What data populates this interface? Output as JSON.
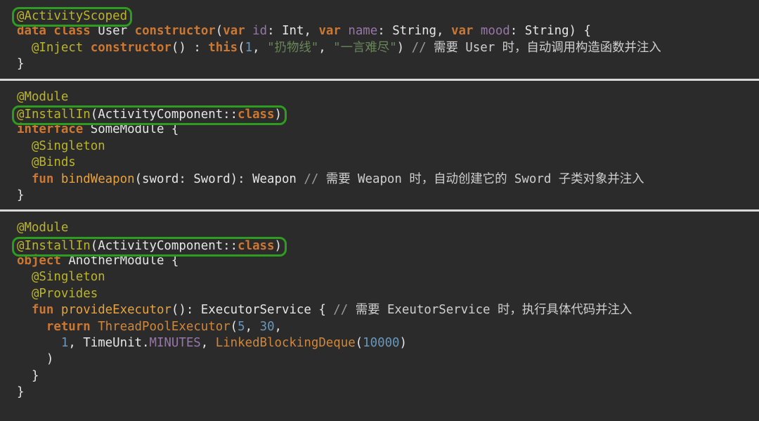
{
  "theme": {
    "background": "#2b2b2b",
    "foreground": "#e6e6e6",
    "keyword": "#cc7832",
    "annotation": "#bbb529",
    "function_name": "#e8a33d",
    "constructor_call": "#d0873a",
    "parameter": "#9876aa",
    "number": "#6897bb",
    "string": "#6a8759",
    "comment": "#9a9a9a",
    "highlight_border": "#2e9b21",
    "separator": "#d8d8d8"
  },
  "blocks": [
    {
      "id": "block-activity-scoped-user",
      "highlighted_annotation": "@ActivityScoped",
      "lines": [
        {
          "id": "b1l1",
          "text": "@ActivityScoped"
        },
        {
          "id": "b1l2",
          "text": "data class User constructor(var id: Int, var name: String, var mood: String) {"
        },
        {
          "id": "b1l3",
          "text": "  @Inject constructor() : this(1, \"扔物线\", \"一言难尽\") // 需要 User 时，自动调用构造函数并注入"
        },
        {
          "id": "b1l4",
          "text": "}"
        }
      ],
      "tokens": {
        "keywords": [
          "data",
          "class",
          "constructor",
          "var",
          "this"
        ],
        "annotations": [
          "@ActivityScoped",
          "@Inject"
        ],
        "types": [
          "User",
          "Int",
          "String"
        ],
        "parameters": [
          "id",
          "name",
          "mood"
        ],
        "numbers": [
          "1"
        ],
        "strings": [
          "\"扔物线\"",
          "\"一言难尽\""
        ],
        "comment": "// 需要 User 时，自动调用构造函数并注入"
      }
    },
    {
      "id": "block-some-module",
      "highlighted_annotation": "@InstallIn(ActivityComponent::class)",
      "lines": [
        {
          "id": "b2l1",
          "text": "@Module"
        },
        {
          "id": "b2l2",
          "text": "@InstallIn(ActivityComponent::class)"
        },
        {
          "id": "b2l3",
          "text": "interface SomeModule {"
        },
        {
          "id": "b2l4",
          "text": "  @Singleton"
        },
        {
          "id": "b2l5",
          "text": "  @Binds"
        },
        {
          "id": "b2l6",
          "text": "  fun bindWeapon(sword: Sword): Weapon // 需要 Weapon 时，自动创建它的 Sword 子类对象并注入"
        },
        {
          "id": "b2l7",
          "text": "}"
        }
      ],
      "tokens": {
        "keywords": [
          "interface",
          "fun",
          "class"
        ],
        "annotations": [
          "@Module",
          "@InstallIn",
          "@Singleton",
          "@Binds"
        ],
        "types": [
          "ActivityComponent",
          "SomeModule",
          "Sword",
          "Weapon"
        ],
        "function_names": [
          "bindWeapon"
        ],
        "parameters": [
          "sword"
        ],
        "comment": "// 需要 Weapon 时，自动创建它的 Sword 子类对象并注入"
      }
    },
    {
      "id": "block-another-module",
      "highlighted_annotation": "@InstallIn(ActivityComponent::class)",
      "lines": [
        {
          "id": "b3l1",
          "text": "@Module"
        },
        {
          "id": "b3l2",
          "text": "@InstallIn(ActivityComponent::class)"
        },
        {
          "id": "b3l3",
          "text": "object AnotherModule {"
        },
        {
          "id": "b3l4",
          "text": "  @Singleton"
        },
        {
          "id": "b3l5",
          "text": "  @Provides"
        },
        {
          "id": "b3l6",
          "text": "  fun provideExecutor(): ExecutorService { // 需要 ExeutorService 时，执行具体代码并注入"
        },
        {
          "id": "b3l7",
          "text": "    return ThreadPoolExecutor(5, 30,"
        },
        {
          "id": "b3l8",
          "text": "      1, TimeUnit.MINUTES, LinkedBlockingDeque(10000)"
        },
        {
          "id": "b3l9",
          "text": "    )"
        },
        {
          "id": "b3l10",
          "text": "  }"
        },
        {
          "id": "b3l11",
          "text": "}"
        }
      ],
      "tokens": {
        "keywords": [
          "object",
          "fun",
          "return",
          "class"
        ],
        "annotations": [
          "@Module",
          "@InstallIn",
          "@Singleton",
          "@Provides"
        ],
        "types": [
          "ActivityComponent",
          "AnotherModule",
          "ExecutorService",
          "TimeUnit"
        ],
        "function_names": [
          "provideExecutor"
        ],
        "constructor_calls": [
          "ThreadPoolExecutor",
          "LinkedBlockingDeque"
        ],
        "constants": [
          "MINUTES"
        ],
        "numbers": [
          "5",
          "30",
          "1",
          "10000"
        ],
        "comment": "// 需要 ExeutorService 时，执行具体代码并注入"
      }
    }
  ],
  "block1": {
    "l1_anno": "@ActivityScoped",
    "l2_data": "data",
    "l2_class": "class",
    "l2_user": "User",
    "l2_constructor": "constructor",
    "l2_paren_open": "(",
    "l2_var1": "var",
    "l2_id": "id",
    "l2_colon1": ": ",
    "l2_int": "Int",
    "l2_comma1": ", ",
    "l2_var2": "var",
    "l2_name": "name",
    "l2_colon2": ": ",
    "l2_string1": "String",
    "l2_comma2": ", ",
    "l2_var3": "var",
    "l2_mood": "mood",
    "l2_colon3": ": ",
    "l2_string2": "String",
    "l2_tail": ") {",
    "l3_inject": "@Inject",
    "l3_constructor": "constructor",
    "l3_parens": "() : ",
    "l3_this": "this",
    "l3_open": "(",
    "l3_num": "1",
    "l3_comma1": ", ",
    "l3_str1": "\"扔物线\"",
    "l3_comma2": ", ",
    "l3_str2": "\"一言难尽\"",
    "l3_close": ") ",
    "l3_slashes": "// ",
    "l3_comment": "需要 User 时，自动调用构造函数并注入",
    "l4_brace": "}"
  },
  "block2": {
    "l1_anno": "@Module",
    "l2_anno": "@InstallIn",
    "l2_open": "(",
    "l2_type": "ActivityComponent::",
    "l2_class": "class",
    "l2_close": ")",
    "l3_interface": "interface",
    "l3_name": "SomeModule {",
    "l4_anno": "@Singleton",
    "l5_anno": "@Binds",
    "l6_fun": "fun",
    "l6_name": "bindWeapon",
    "l6_sig": "(sword: Sword): Weapon ",
    "l6_slashes": "// ",
    "l6_comment": "需要 Weapon 时，自动创建它的 Sword 子类对象并注入",
    "l7_brace": "}"
  },
  "block3": {
    "l1_anno": "@Module",
    "l2_anno": "@InstallIn",
    "l2_open": "(",
    "l2_type": "ActivityComponent::",
    "l2_class": "class",
    "l2_close": ")",
    "l3_object": "object",
    "l3_name": "AnotherModule {",
    "l4_anno": "@Singleton",
    "l5_anno": "@Provides",
    "l6_fun": "fun",
    "l6_name": "provideExecutor",
    "l6_sig": "(): ExecutorService { ",
    "l6_slashes": "// ",
    "l6_comment": "需要 ExeutorService 时，执行具体代码并注入",
    "l7_return": "return",
    "l7_ctor": "ThreadPoolExecutor",
    "l7_open": "(",
    "l7_n1": "5",
    "l7_comma1": ", ",
    "l7_n2": "30",
    "l7_comma2": ",",
    "l8_n1": "1",
    "l8_mid": ", TimeUnit.",
    "l8_const": "MINUTES",
    "l8_comma": ", ",
    "l8_ctor": "LinkedBlockingDeque",
    "l8_open": "(",
    "l8_n2": "10000",
    "l8_close": ")",
    "l9_close": "  )",
    "l10_brace": "  }",
    "l11_brace": "}"
  }
}
